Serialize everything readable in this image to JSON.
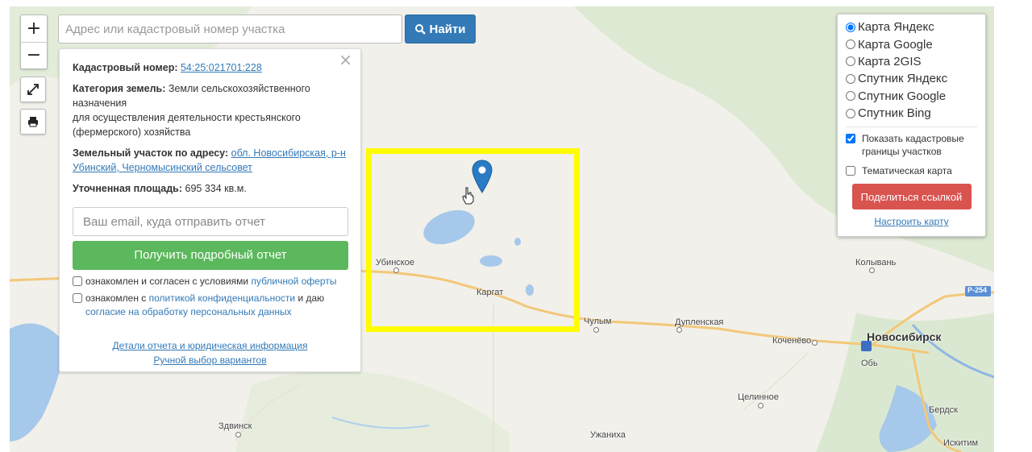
{
  "search": {
    "placeholder": "Адрес или кадастровый номер участка",
    "button_label": "Найти"
  },
  "zoom": {
    "in_label": "+",
    "out_label": "−"
  },
  "icons": {
    "zoom_in": "plus-icon",
    "zoom_out": "minus-icon",
    "fullscreen": "expand-icon",
    "print": "print-icon",
    "search": "search-icon",
    "close": "close-icon",
    "marker": "map-pin-icon",
    "cursor": "hand-pointer-icon"
  },
  "info": {
    "close_label": "×",
    "cadastral_label": "Кадастровый номер:",
    "cadastral_value": "54:25:021701:228",
    "category_label": "Категория земель:",
    "category_value": "Земли сельскохозяйственного назначения",
    "category_value_2": "для осуществления деятельности крестьянского (фермерского) хозяйства",
    "address_label": "Земельный участок по адресу:",
    "address_value": "обл. Новосибирская, р-н Убинский, Черномысинский сельсовет",
    "area_label": "Уточненная площадь:",
    "area_value": "695 334 кв.м.",
    "email_placeholder": "Ваш email, куда отправить отчет",
    "report_button": "Получить подробный отчет",
    "agree1_text": "ознакомлен и согласен с условиями",
    "agree1_link": "публичной оферты",
    "agree2_text": "ознакомлен с",
    "agree2_link": "политикой конфиденциальности",
    "agree2_mid": "и даю",
    "agree2_link2": "согласие на обработку персональных данных",
    "details_link": "Детали отчета и юридическая информация",
    "manual_link": "Ручной выбор вариантов"
  },
  "layers": {
    "options": [
      "Карта Яндекс",
      "Карта Google",
      "Карта 2GIS",
      "Спутник Яндекс",
      "Спутник Google",
      "Спутник Bing"
    ],
    "selected": "Карта Яндекс",
    "cadastral_checkbox": "Показать кадастровые границы участков",
    "cadastral_checked": true,
    "thematic_checkbox": "Тематическая карта",
    "thematic_checked": false,
    "share_button": "Поделиться ссылкой",
    "configure_link": "Настроить карту"
  },
  "map": {
    "places": [
      "Убинское",
      "Каргат",
      "Чулым",
      "Дупленская",
      "Коченёво",
      "Новосибирск",
      "Обь",
      "Колывань",
      "Целинное",
      "Здвинск",
      "Ужаниха",
      "Бердск",
      "Искитим"
    ],
    "road_label": "Р-254",
    "highlight_color": "#fffc00"
  }
}
